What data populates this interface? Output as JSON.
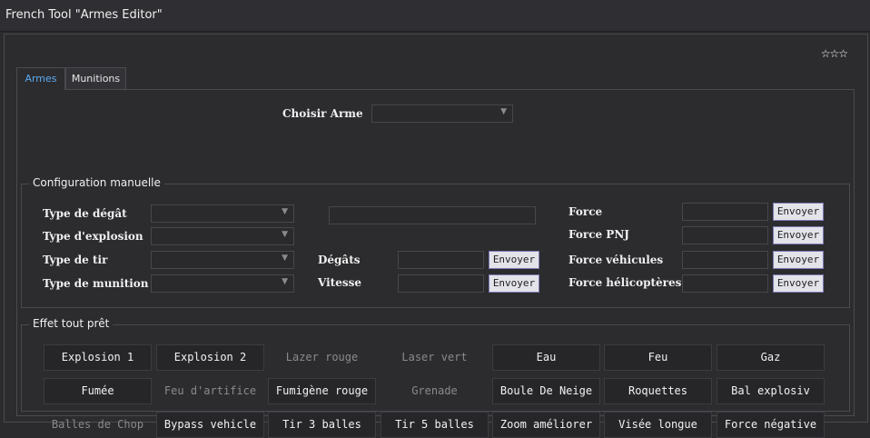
{
  "window": {
    "title": "French Tool \"Armes Editor\"",
    "stars": "☆☆☆"
  },
  "tabs": [
    {
      "label": "Armes"
    },
    {
      "label": "Munitions"
    }
  ],
  "weapon": {
    "label": "Choisir Arme",
    "value": ""
  },
  "manual": {
    "legend": "Configuration manuelle",
    "left": [
      {
        "label": "Type de dégât",
        "value": ""
      },
      {
        "label": "Type d'explosion",
        "value": ""
      },
      {
        "label": "Type de tir",
        "value": ""
      },
      {
        "label": "Type de munition",
        "value": ""
      }
    ],
    "middle": [
      {
        "label": "Dégâts",
        "button": "Envoyer"
      },
      {
        "label": "Vitesse",
        "button": "Envoyer"
      }
    ],
    "right": [
      {
        "label": "Force",
        "button": "Envoyer"
      },
      {
        "label": "Force PNJ",
        "button": "Envoyer"
      },
      {
        "label": "Force véhicules",
        "button": "Envoyer"
      },
      {
        "label": "Force hélicoptères",
        "button": "Envoyer"
      }
    ]
  },
  "effects": {
    "legend": "Effet tout prêt",
    "buttons": [
      {
        "label": "Explosion 1",
        "enabled": true
      },
      {
        "label": "Explosion 2",
        "enabled": true
      },
      {
        "label": "Lazer rouge",
        "enabled": false
      },
      {
        "label": "Laser vert",
        "enabled": false
      },
      {
        "label": "Eau",
        "enabled": true
      },
      {
        "label": "Feu",
        "enabled": true
      },
      {
        "label": "Gaz",
        "enabled": true
      },
      {
        "label": "Fumée",
        "enabled": true
      },
      {
        "label": "Feu d'artifice",
        "enabled": false
      },
      {
        "label": "Fumigène rouge",
        "enabled": true
      },
      {
        "label": "Grenade",
        "enabled": false
      },
      {
        "label": "Boule De Neige",
        "enabled": true
      },
      {
        "label": "Roquettes",
        "enabled": true
      },
      {
        "label": "Bal explosiv",
        "enabled": true
      },
      {
        "label": "Balles de Chop",
        "enabled": false
      },
      {
        "label": "Bypass vehicle",
        "enabled": true
      },
      {
        "label": "Tir 3 balles",
        "enabled": true
      },
      {
        "label": "Tir 5 balles",
        "enabled": true
      },
      {
        "label": "Zoom améliorer",
        "enabled": true
      },
      {
        "label": "Visée longue",
        "enabled": true
      },
      {
        "label": "Force négative",
        "enabled": true
      }
    ]
  }
}
